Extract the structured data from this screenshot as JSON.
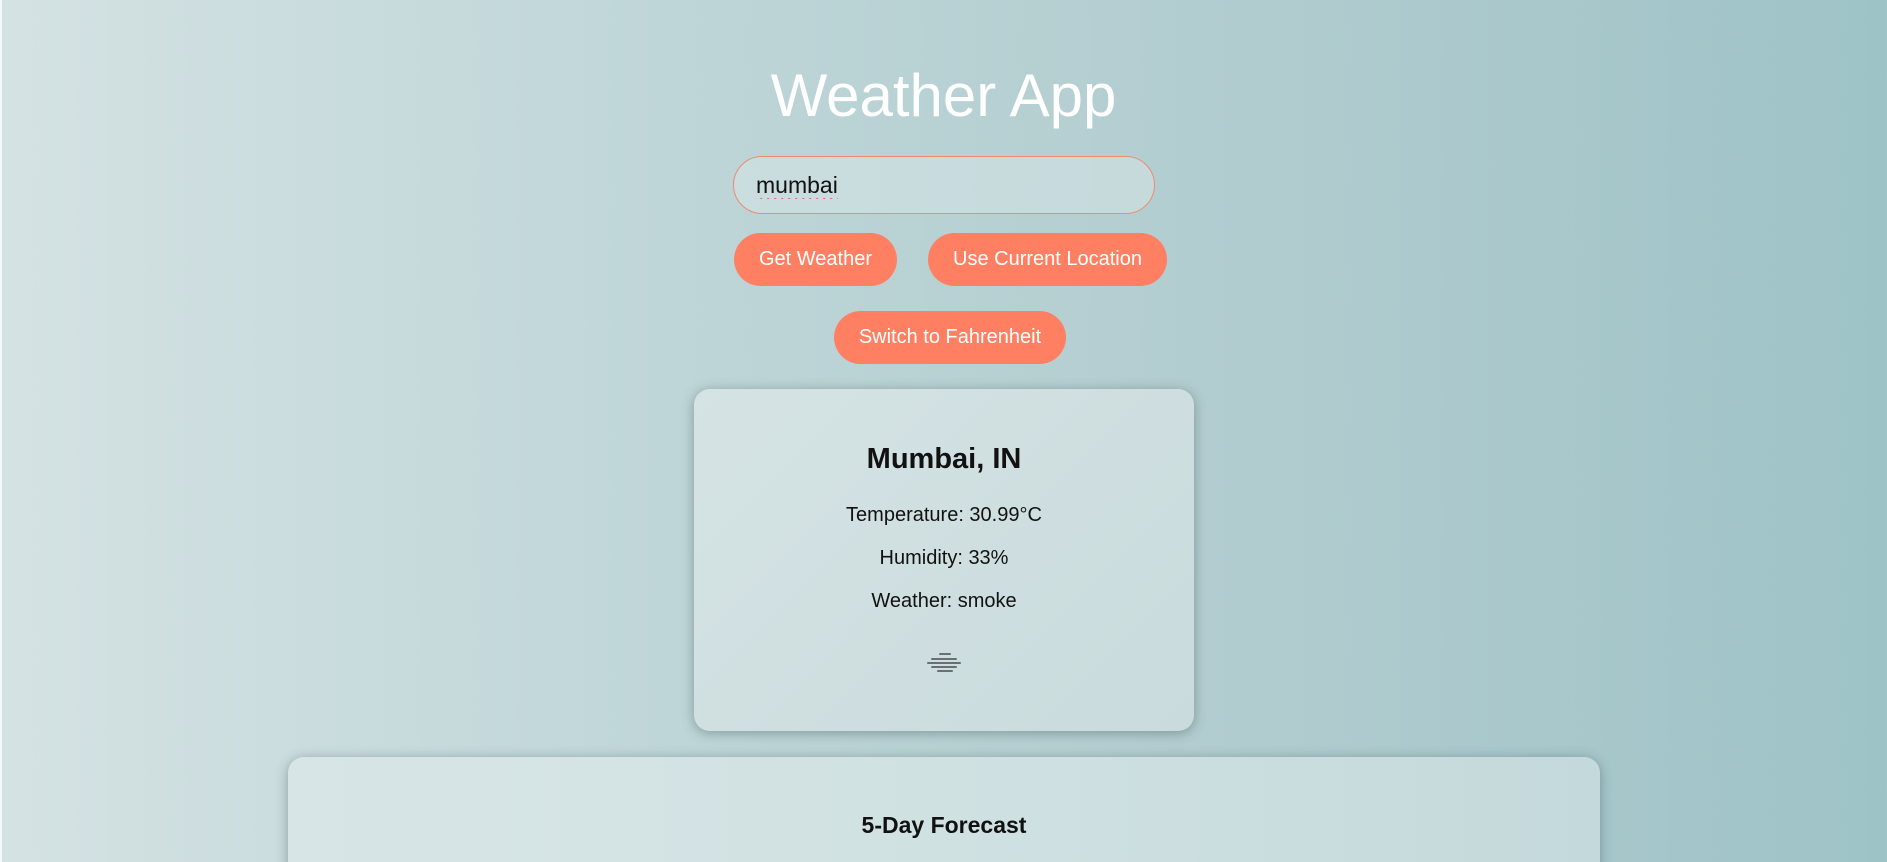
{
  "app": {
    "title": "Weather App"
  },
  "search": {
    "value": "mumbai"
  },
  "buttons": {
    "get_weather": "Get Weather",
    "use_location": "Use Current Location",
    "switch_unit": "Switch to Fahrenheit"
  },
  "current": {
    "city": "Mumbai, IN",
    "temperature": "Temperature: 30.99°C",
    "humidity": "Humidity: 33%",
    "weather": "Weather: smoke",
    "icon": "smoke-icon"
  },
  "forecast": {
    "title": "5-Day Forecast"
  },
  "colors": {
    "accent": "#ff7f63",
    "title_text": "#ffffff",
    "input_border": "#f08b6e"
  }
}
